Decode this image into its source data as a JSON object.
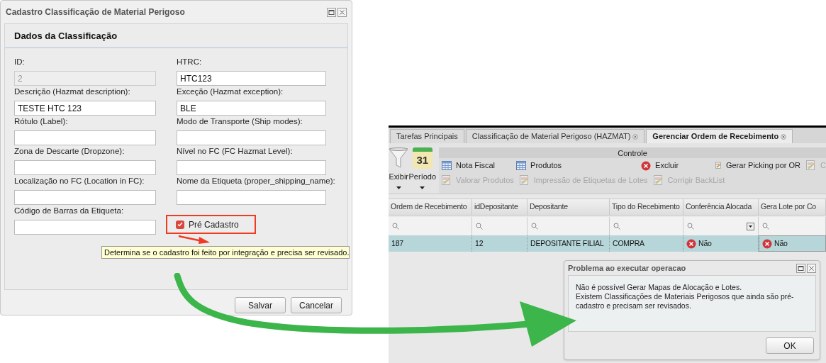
{
  "form_window": {
    "title": "Cadastro Classificação de Material Perigoso",
    "section_title": "Dados da Classificação",
    "fields": [
      {
        "label": "ID:",
        "value": "2",
        "disabled": true
      },
      {
        "label": "HTRC:",
        "value": "HTC123",
        "disabled": false
      },
      {
        "label": "Descrição (Hazmat description):",
        "value": "TESTE HTC 123",
        "disabled": false
      },
      {
        "label": "Exceção (Hazmat exception):",
        "value": "BLE",
        "disabled": false
      },
      {
        "label": "Rótulo (Label):",
        "disabled": false
      },
      {
        "label": "Modo de Transporte (Ship modes):",
        "disabled": false
      },
      {
        "label": "Zona de Descarte (Dropzone):",
        "disabled": false
      },
      {
        "label": "Nível no FC (FC Hazmat Level):",
        "disabled": false
      },
      {
        "label": "Localização no FC (Location in FC):",
        "disabled": false
      },
      {
        "label": "Nome da Etiqueta (proper_shipping_name):",
        "disabled": false
      },
      {
        "label": "Código de Barras da Etiqueta:",
        "disabled": false
      }
    ],
    "checkbox": {
      "label": "Pré Cadastro",
      "checked": true
    },
    "tooltip": "Determina se o cadastro foi feito por integração e precisa ser revisado.",
    "buttons": [
      "Salvar",
      "Cancelar"
    ]
  },
  "main_window": {
    "tabs": [
      {
        "label": "Tarefas Principais",
        "selected": false,
        "closable": false
      },
      {
        "label": "Classificação de Material Perigoso (HAZMAT)",
        "selected": false,
        "closable": true
      },
      {
        "label": "Gerenciar Ordem de Recebimento",
        "selected": true,
        "closable": true
      }
    ],
    "toolbar": {
      "left_buttons": [
        {
          "label": "Exibir",
          "kind": "filter"
        },
        {
          "label": "Período",
          "kind": "calendar",
          "day": "31"
        }
      ],
      "group_title": "Controle",
      "rows": [
        [
          {
            "label": "Nota Fiscal",
            "kind": "table",
            "disabled": false
          },
          {
            "label": "Produtos",
            "kind": "table",
            "disabled": false
          },
          {
            "label": "Excluir",
            "kind": "delete",
            "disabled": false
          },
          {
            "label": "Gerar Picking por OR",
            "kind": "report",
            "disabled": false
          },
          {
            "label": "C",
            "kind": "report",
            "disabled": true
          }
        ],
        [
          {
            "label": "Valorar Produtos",
            "kind": "report",
            "disabled": true
          },
          {
            "label": "Impressão de Etiquetas de Lotes",
            "kind": "report",
            "disabled": true
          },
          {
            "label": "Corrigir BackList",
            "kind": "report",
            "disabled": true
          }
        ]
      ]
    },
    "table": {
      "columns": [
        "Ordem de Recebimento",
        "idDepositante",
        "Depositante",
        "Tipo do Recebimento",
        "Conferência Alocada",
        "Gera Lote por Co"
      ],
      "rows": [
        {
          "selected": true,
          "cells": [
            {
              "kind": "text",
              "text": "187"
            },
            {
              "kind": "text",
              "text": "12"
            },
            {
              "kind": "text",
              "text": "DEPOSITANTE FILIAL"
            },
            {
              "kind": "text",
              "text": "COMPRA"
            },
            {
              "kind": "no",
              "text": "Não"
            },
            {
              "kind": "no",
              "text": "Não"
            }
          ]
        }
      ]
    },
    "error_dialog": {
      "title": "Problema ao executar operacao",
      "lines": [
        "Não é possível Gerar Mapas de Alocação e Lotes.",
        "Existem Classificações de Materiais Perigosos que ainda são pré-cadastro e precisam ser revisados."
      ],
      "button": "OK"
    }
  }
}
